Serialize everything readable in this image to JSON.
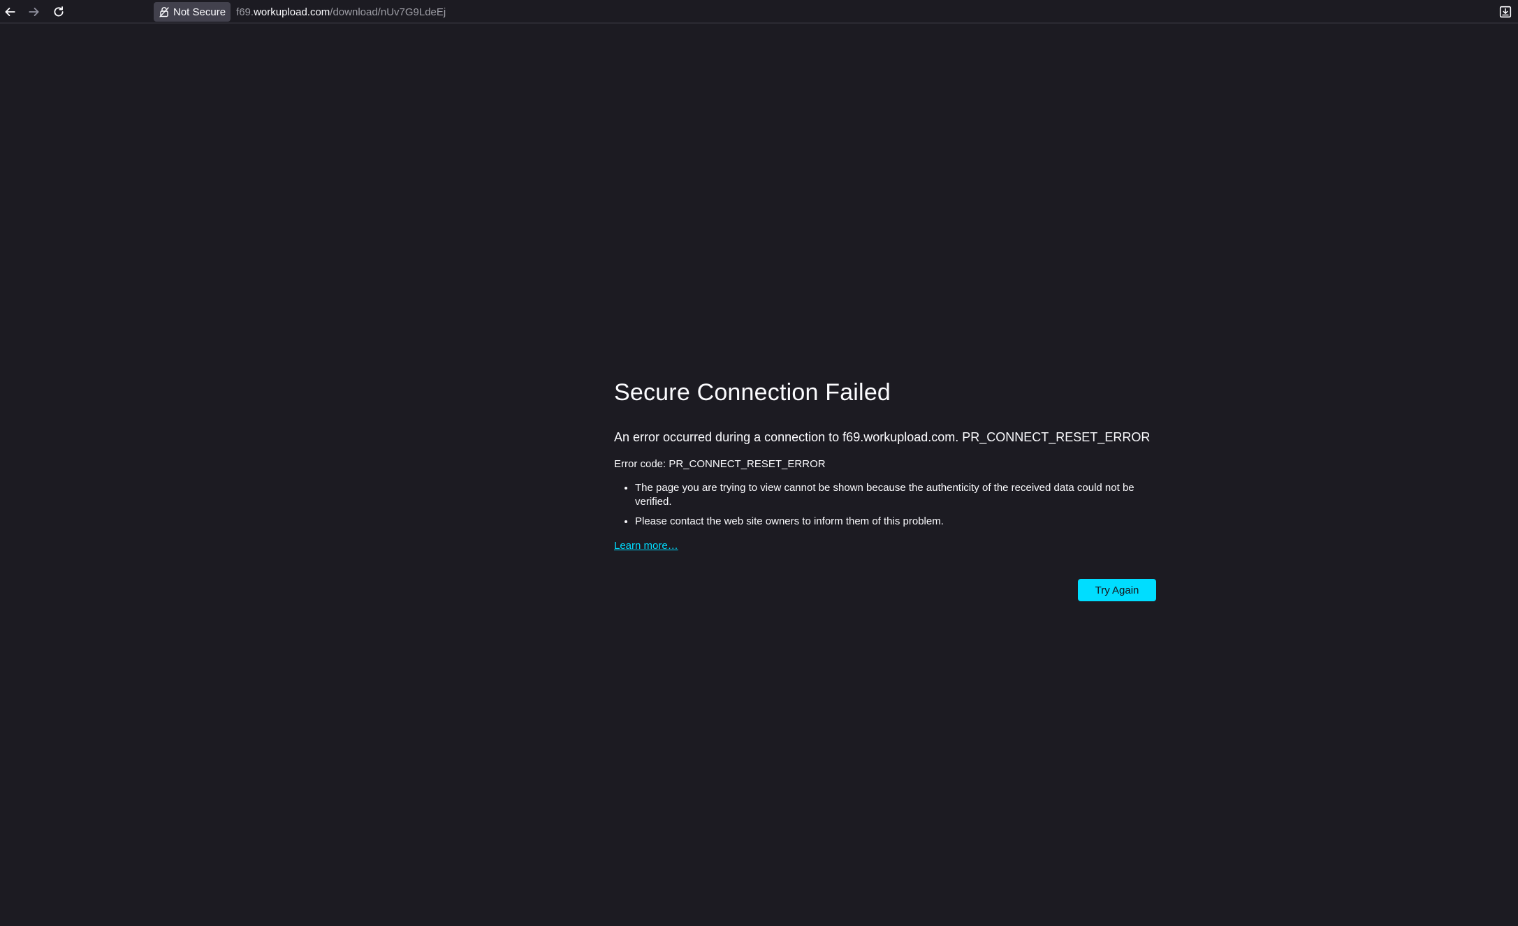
{
  "browser": {
    "security_label": "Not Secure",
    "url": {
      "prefix": "f69.",
      "host": "workupload.com",
      "path": "/download/nUv7G9LdeEj"
    },
    "icons": {
      "back": "back-arrow-icon",
      "forward": "forward-arrow-icon",
      "reload": "reload-icon",
      "security": "broken-lock-icon",
      "downloads": "download-icon"
    }
  },
  "error_page": {
    "title": "Secure Connection Failed",
    "description": "An error occurred during a connection to f69.workupload.com. PR_CONNECT_RESET_ERROR",
    "error_code": "Error code: PR_CONNECT_RESET_ERROR",
    "bullets": [
      "The page you are trying to view cannot be shown because the authenticity of the received data could not be verified.",
      "Please contact the web site owners to inform them of this problem."
    ],
    "learn_more": "Learn more…",
    "try_again": "Try Again"
  },
  "colors": {
    "background": "#1c1b22",
    "accent": "#00ddff",
    "text": "#fbfbfe",
    "badge": "#42414d"
  }
}
